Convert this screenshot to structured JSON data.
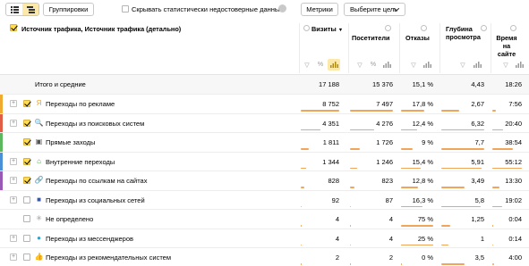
{
  "toolbar": {
    "group_button": "Группировки",
    "hide_label": "Скрывать статистически недостоверные данные",
    "metrics_button": "Метрики",
    "goal_button": "Выберите цель"
  },
  "header": {
    "dimension_title": "Источник трафика, Источник трафика (детально)",
    "visits": "Визиты",
    "visitors": "Посетители",
    "bounces": "Отказы",
    "depth_l1": "Глубина",
    "depth_l2": "просмотра",
    "time_l1": "Время",
    "time_l2": "на",
    "time_l3": "сайте",
    "sort_arrow": "▼"
  },
  "totals": {
    "label": "Итого и средние",
    "visits": "17 188",
    "visitors": "15 376",
    "bounces": "15,1 %",
    "depth": "4,43",
    "time": "18:26"
  },
  "rows": [
    {
      "label": "Переходы по рекламе",
      "icon": "direct-ad-icon",
      "icon_char": "Я",
      "icon_color": "#f5a623",
      "stripe": "#f0aa30",
      "expandable": true,
      "checked": true,
      "visits": "8 752",
      "visitors": "7 497",
      "bounces": "17,8 %",
      "depth": "2,67",
      "time": "7:56",
      "fill": {
        "visits": 1.0,
        "visitors": 1.0,
        "bounces": 0.72,
        "depth": 0.42,
        "time": 0.13
      }
    },
    {
      "label": "Переходы из поисковых систем",
      "icon": "search-engine-icon",
      "icon_char": "🔍",
      "icon_color": "#c0392b",
      "stripe": "#e25d45",
      "expandable": true,
      "checked": true,
      "visits": "4 351",
      "visitors": "4 276",
      "bounces": "12,4 %",
      "depth": "6,32",
      "time": "20:40",
      "fill": {
        "visits": 0.5,
        "visitors": 0.57,
        "bounces": 0.5,
        "depth": 1.0,
        "time": 0.36
      }
    },
    {
      "label": "Прямые заходы",
      "icon": "direct-visit-icon",
      "icon_char": "▣",
      "icon_color": "#555555",
      "stripe": "#5cb85c",
      "expandable": false,
      "checked": true,
      "visits": "1 811",
      "visitors": "1 726",
      "bounces": "9 %",
      "depth": "7,7",
      "time": "38:54",
      "fill": {
        "visits": 0.21,
        "visitors": 0.23,
        "bounces": 0.36,
        "depth": 1.0,
        "time": 0.7
      }
    },
    {
      "label": "Внутренние переходы",
      "icon": "home-icon",
      "icon_char": "⌂",
      "icon_color": "#3aa03a",
      "stripe": "#4a90d9",
      "expandable": true,
      "checked": true,
      "visits": "1 344",
      "visitors": "1 246",
      "bounces": "15,4 %",
      "depth": "5,91",
      "time": "55:12",
      "fill": {
        "visits": 0.15,
        "visitors": 0.17,
        "bounces": 0.62,
        "depth": 0.93,
        "time": 1.0
      }
    },
    {
      "label": "Переходы по ссылкам на сайтах",
      "icon": "link-icon",
      "icon_char": "🔗",
      "icon_color": "#3a74c8",
      "stripe": "#9b59b6",
      "expandable": true,
      "checked": true,
      "visits": "828",
      "visitors": "823",
      "bounces": "12,8 %",
      "depth": "3,49",
      "time": "13:30",
      "fill": {
        "visits": 0.09,
        "visitors": 0.11,
        "bounces": 0.52,
        "depth": 0.55,
        "time": 0.24
      }
    },
    {
      "label": "Переходы из социальных сетей",
      "icon": "social-network-icon",
      "icon_char": "■",
      "icon_color": "#3b5998",
      "stripe": "",
      "expandable": true,
      "checked": false,
      "visits": "92",
      "visitors": "87",
      "bounces": "16,3 %",
      "depth": "5,8",
      "time": "19:02",
      "fill": {
        "visits": 0.01,
        "visitors": 0.01,
        "bounces": 0.66,
        "depth": 0.92,
        "time": 0.34
      }
    },
    {
      "label": "Не определено",
      "icon": "undefined-source-icon",
      "icon_char": "✳",
      "icon_color": "#999999",
      "stripe": "",
      "expandable": false,
      "checked": false,
      "visits": "4",
      "visitors": "4",
      "bounces": "75 %",
      "depth": "1,25",
      "time": "0:04",
      "fill": {
        "visits": 0.005,
        "visitors": 0.005,
        "bounces": 1.0,
        "depth": 0.2,
        "time": 0.01
      }
    },
    {
      "label": "Переходы из мессенджеров",
      "icon": "messenger-icon",
      "icon_char": "●",
      "icon_color": "#2aa3d9",
      "stripe": "",
      "expandable": true,
      "checked": false,
      "visits": "4",
      "visitors": "4",
      "bounces": "25 %",
      "depth": "1",
      "time": "0:14",
      "fill": {
        "visits": 0.005,
        "visitors": 0.005,
        "bounces": 1.0,
        "depth": 0.16,
        "time": 0.02
      }
    },
    {
      "label": "Переходы из рекомендательных систем",
      "icon": "recommendation-icon",
      "icon_char": "👍",
      "icon_color": "#7b3fb8",
      "stripe": "",
      "expandable": true,
      "checked": false,
      "visits": "2",
      "visitors": "2",
      "bounces": "0 %",
      "depth": "3,5",
      "time": "4:00",
      "fill": {
        "visits": 0.003,
        "visitors": 0.003,
        "bounces": 0.0,
        "depth": 0.55,
        "time": 0.07
      }
    }
  ],
  "colors": {
    "accent": "#fce9a9",
    "bar": "#f0a55a",
    "checkbox": "#ffdb4d"
  }
}
